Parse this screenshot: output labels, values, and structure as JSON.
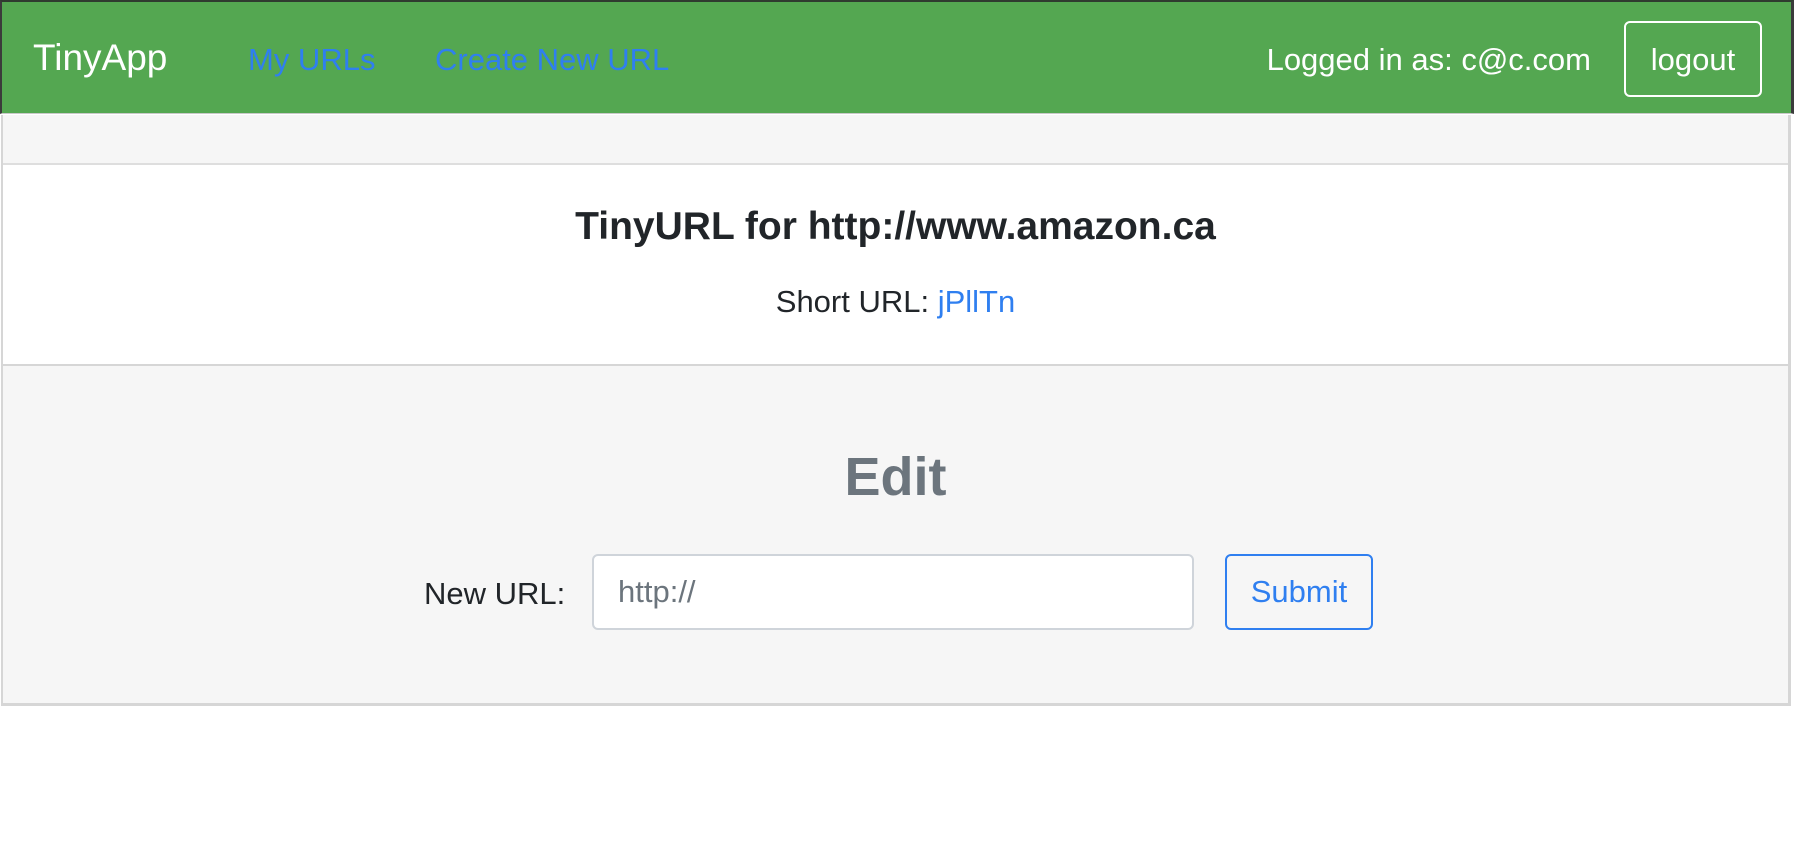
{
  "navbar": {
    "brand": "TinyApp",
    "links": [
      {
        "label": "My URLs"
      },
      {
        "label": "Create New URL"
      }
    ],
    "logged_in_text": "Logged in as: c@c.com",
    "logout_label": "logout",
    "background_color": "#54a751",
    "link_color": "#2f7ff0"
  },
  "url_card": {
    "title": "TinyURL for http://www.amazon.ca",
    "short_url_label": "Short URL: ",
    "short_url_value": "jPllTn"
  },
  "edit_form": {
    "heading": "Edit",
    "field_label": "New URL:",
    "input_value": "",
    "input_placeholder": "http://",
    "submit_label": "Submit",
    "accent_color": "#2f7ff0"
  }
}
